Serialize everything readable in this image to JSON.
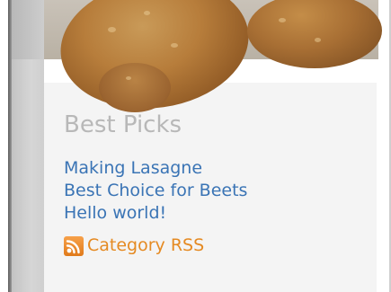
{
  "widget": {
    "title": "Best Picks",
    "links": [
      {
        "label": "Making Lasagne"
      },
      {
        "label": "Best Choice for Beets"
      },
      {
        "label": "Hello world!"
      }
    ],
    "rss": {
      "label": "Category RSS",
      "icon": "rss-icon"
    }
  },
  "header_image": {
    "subject": "cookies"
  },
  "colors": {
    "link": "#3a74b5",
    "rss_link": "#e58a22",
    "title": "#b8b8b8",
    "widget_background": "#f4f4f4"
  }
}
